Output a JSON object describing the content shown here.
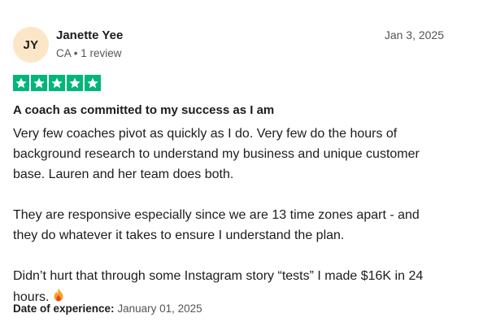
{
  "reviewer": {
    "initials": "JY",
    "name": "Janette Yee",
    "meta": "CA • 1 review"
  },
  "review": {
    "date": "Jan 3, 2025",
    "rating": 5,
    "star_color": "#00b67a",
    "title": "A coach as committed to my success as I am",
    "paragraphs": [
      "Very few coaches pivot as quickly as I do. Very few do the hours of\nbackground research to understand my business and unique customer\nbase. Lauren and her team does both.",
      "They are responsive especially since we are 13 time zones apart - and\nthey do whatever it takes to ensure I understand the plan.",
      "Didn’t hurt that through some Instagram story “tests” I made $16K in 24\nhours."
    ],
    "emoji": "fire-icon",
    "experience_label": "Date of experience:",
    "experience_date": "January 01, 2025"
  }
}
